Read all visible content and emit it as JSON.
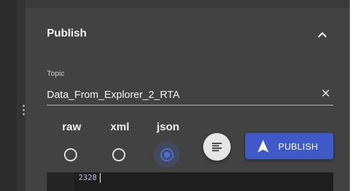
{
  "publish_panel": {
    "title": "Publish",
    "collapse_icon": "chevron-up-icon",
    "topic": {
      "label": "Topic",
      "value": "Data_From_Explorer_2_RTA",
      "clear_icon": "close-icon"
    },
    "formats": [
      {
        "label": "raw",
        "selected": false
      },
      {
        "label": "xml",
        "selected": false
      },
      {
        "label": "json",
        "selected": true
      }
    ],
    "format_button_icon": "format-align-icon",
    "publish_button": {
      "label": "PUBLISH",
      "icon": "send-icon"
    },
    "editor": {
      "content": "2328"
    }
  },
  "colors": {
    "panel_bg": "#424242",
    "accent": "#3f5ac8",
    "radio_selected": "#4a6fdc",
    "editor_bg": "#1e1e1e"
  }
}
